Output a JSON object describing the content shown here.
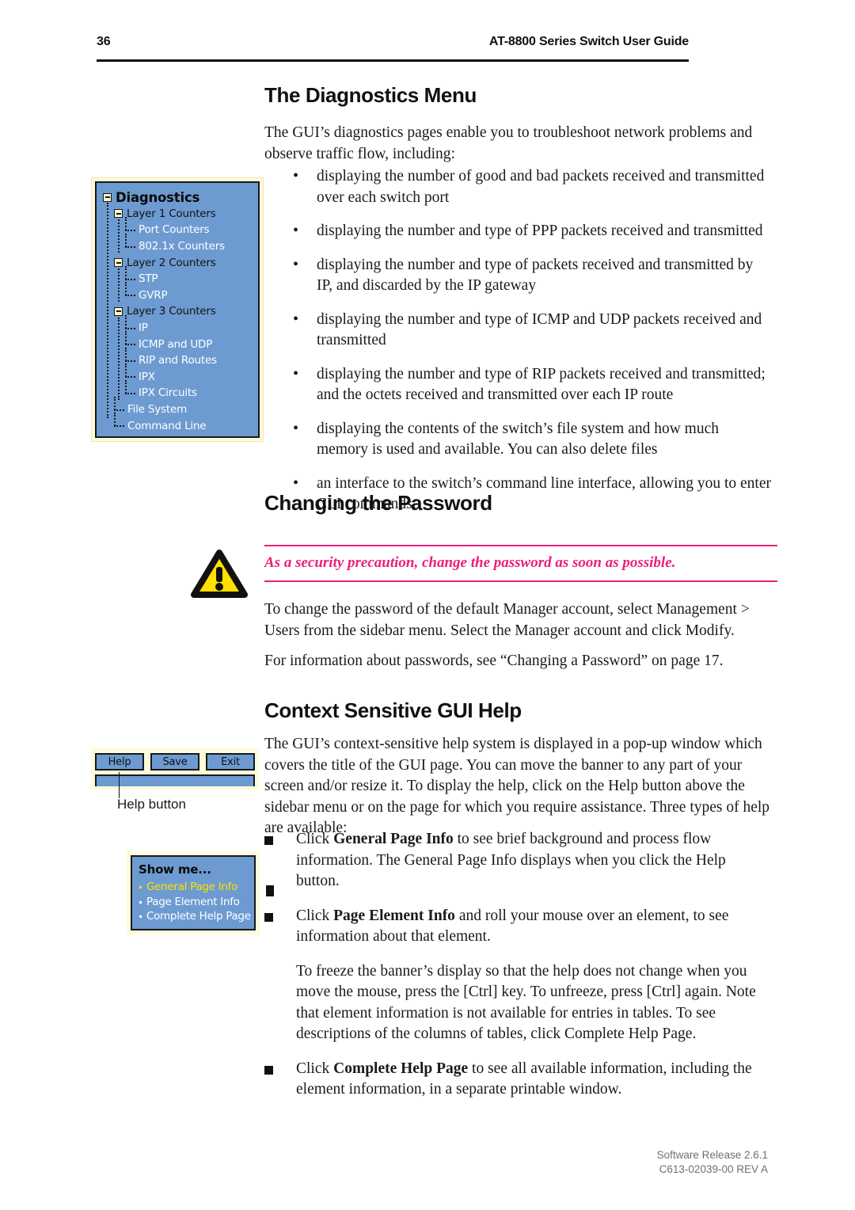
{
  "header": {
    "page_number": "36",
    "guide_title": "AT-8800 Series Switch User Guide"
  },
  "sections": {
    "diagnostics": {
      "heading": "The Diagnostics Menu",
      "intro": "The GUI’s diagnostics pages enable you to troubleshoot network problems and observe traffic flow, including:",
      "bullets": [
        "displaying the number of good and bad packets received and transmitted over each switch port",
        "displaying the number and type of PPP packets received and transmitted",
        "displaying the number and type of packets received and transmitted by IP, and discarded by the IP gateway",
        "displaying the number and type of ICMP and UDP packets received and transmitted",
        "displaying the number and type of RIP packets received and transmitted; and the octets received and transmitted over each IP route",
        "displaying the contents of the switch’s file system and how much memory is used and available. You can also delete files",
        "an interface to the switch’s command line interface, allowing you to enter CLI commands."
      ]
    },
    "password": {
      "heading": "Changing the Password",
      "note": "As a security precaution, change the password as soon as possible.",
      "paragraph1": "To change the password of the default Manager account, select Management > Users from the sidebar menu. Select the Manager account and click Modify.",
      "paragraph2": "For information about passwords, see “Changing a Password” on page 17."
    },
    "help": {
      "heading": "Context Sensitive GUI Help",
      "intro": "The GUI’s context-sensitive help system is displayed in a pop-up window which covers the title of the GUI page. You can move the banner to any part of your screen and/or resize it. To display the help, click on the Help button above the sidebar menu or on the page for which you require assistance. Three types of help are available:",
      "items": [
        {
          "lead": "Click ",
          "term": "General Page Info",
          "rest": " to see brief background and process flow information. The General Page Info displays when you click the Help button."
        },
        {
          "lead": "Click ",
          "term": "Page Element Info",
          "rest": " and roll your mouse over an element, to see information about that element."
        }
      ],
      "freeze_paragraph": "To freeze the banner’s display so that the help does not change when you move the mouse, press the [Ctrl] key. To unfreeze, press [Ctrl] again. Note that element information is not available for entries in tables. To see descriptions of the columns of tables, click Complete Help Page.",
      "last_item": {
        "lead": "Click ",
        "term": "Complete Help Page",
        "rest": " to see all available information, including the element information, in a separate printable window."
      }
    }
  },
  "figures": {
    "diagnostics_tree": {
      "root": "Diagnostics",
      "items": [
        {
          "label": "Layer 1 Counters",
          "level": 1,
          "type": "node"
        },
        {
          "label": "Port Counters",
          "level": 2,
          "type": "leaf"
        },
        {
          "label": "802.1x Counters",
          "level": 2,
          "type": "leaf"
        },
        {
          "label": "Layer 2 Counters",
          "level": 1,
          "type": "node"
        },
        {
          "label": "STP",
          "level": 2,
          "type": "leaf"
        },
        {
          "label": "GVRP",
          "level": 2,
          "type": "leaf"
        },
        {
          "label": "Layer 3 Counters",
          "level": 1,
          "type": "node"
        },
        {
          "label": "IP",
          "level": 2,
          "type": "leaf"
        },
        {
          "label": "ICMP and UDP",
          "level": 2,
          "type": "leaf"
        },
        {
          "label": "RIP and Routes",
          "level": 2,
          "type": "leaf"
        },
        {
          "label": "IPX",
          "level": 2,
          "type": "leaf"
        },
        {
          "label": "IPX Circuits",
          "level": 2,
          "type": "leaf"
        },
        {
          "label": "File System",
          "level": 1,
          "type": "leaf"
        },
        {
          "label": "Command Line",
          "level": 1,
          "type": "leaf"
        }
      ]
    },
    "buttons": {
      "help": "Help",
      "save": "Save",
      "exit": "Exit",
      "callout": "Help button"
    },
    "show_me": {
      "title": "Show me...",
      "items": [
        {
          "label": "General Page Info",
          "state": "active"
        },
        {
          "label": "Page Element Info",
          "state": "normal"
        },
        {
          "label": "Complete Help Page",
          "state": "normal"
        }
      ]
    }
  },
  "footer": {
    "line1": "Software Release 2.6.1",
    "line2": "C613-02039-00 REV A"
  },
  "colors": {
    "note_pink": "#ec1e79",
    "gui_blue": "#6d9bd1",
    "figure_cream": "#fdfbd9",
    "active_yellow": "#ffe000"
  }
}
